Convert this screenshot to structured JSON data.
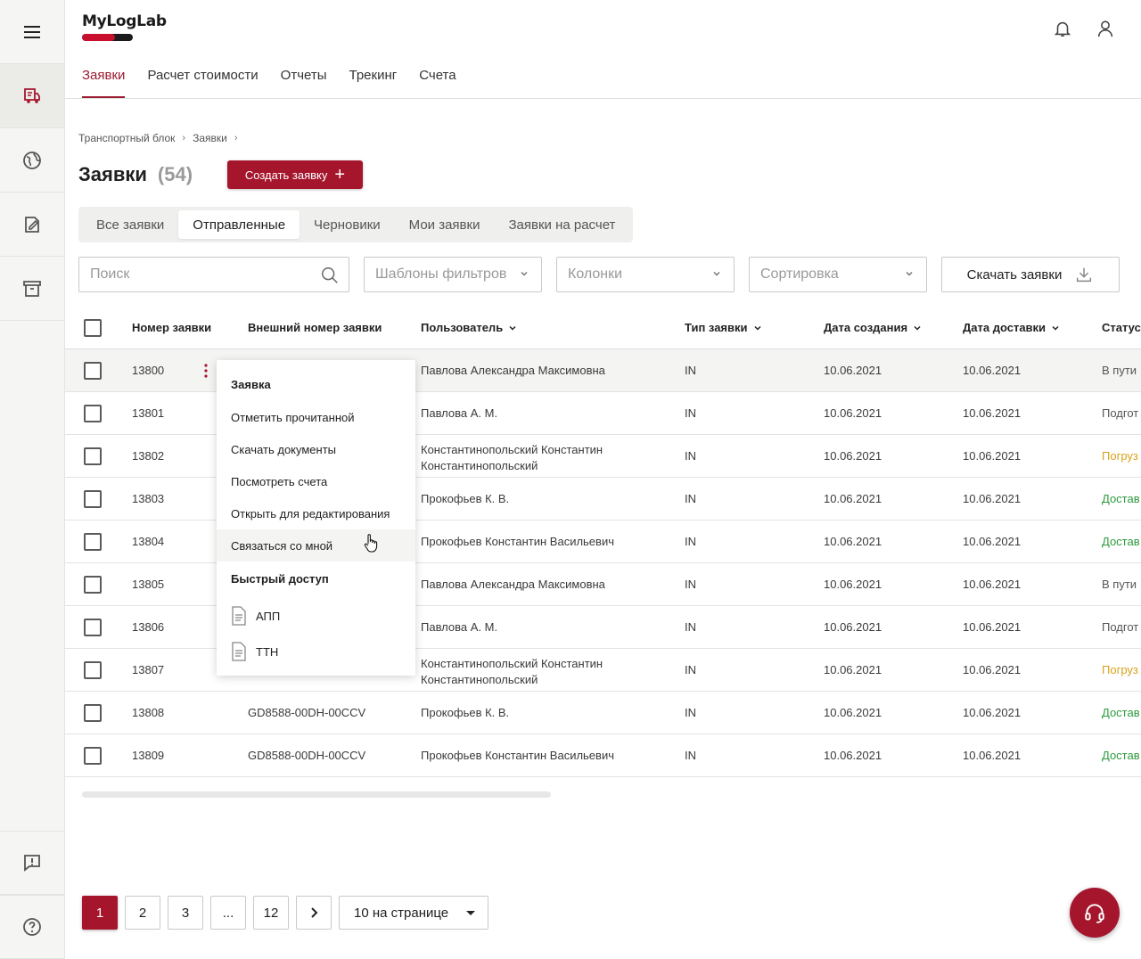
{
  "app": {
    "logo": "MyLogLab"
  },
  "topnav": [
    "Заявки",
    "Расчет стоимости",
    "Отчеты",
    "Трекинг",
    "Счета"
  ],
  "breadcrumb": [
    "Транспортный блок",
    "Заявки"
  ],
  "page": {
    "title": "Заявки",
    "count": "(54)",
    "create_label": "Создать заявку"
  },
  "segments": [
    "Все заявки",
    "Отправленные",
    "Черновики",
    "Мои заявки",
    "Заявки на расчет"
  ],
  "filters": {
    "search_placeholder": "Поиск",
    "templates": "Шаблоны фильтров",
    "columns": "Колонки",
    "sort": "Сортировка",
    "download_label": "Скачать заявки"
  },
  "table": {
    "headers": [
      "Номер заявки",
      "Внешний номер заявки",
      "Пользователь",
      "Тип заявки",
      "Дата создания",
      "Дата доставки",
      "Статус"
    ],
    "rows": [
      {
        "num": "13800",
        "ext": "",
        "user": "Павлова Александра Максимовна",
        "type": "IN",
        "created": "10.06.2021",
        "delivery": "10.06.2021",
        "status": "В пути"
      },
      {
        "num": "13801",
        "ext": "",
        "user": "Павлова А. М.",
        "type": "IN",
        "created": "10.06.2021",
        "delivery": "10.06.2021",
        "status": "Подгот"
      },
      {
        "num": "13802",
        "ext": "",
        "user": "Константинопольский Константин Константинопольский",
        "type": "IN",
        "created": "10.06.2021",
        "delivery": "10.06.2021",
        "status": "Погруз"
      },
      {
        "num": "13803",
        "ext": "",
        "user": "Прокофьев К. В.",
        "type": "IN",
        "created": "10.06.2021",
        "delivery": "10.06.2021",
        "status": "Достав"
      },
      {
        "num": "13804",
        "ext": "",
        "user": "Прокофьев Константин Васильевич",
        "type": "IN",
        "created": "10.06.2021",
        "delivery": "10.06.2021",
        "status": "Достав"
      },
      {
        "num": "13805",
        "ext": "",
        "user": "Павлова Александра Максимовна",
        "type": "IN",
        "created": "10.06.2021",
        "delivery": "10.06.2021",
        "status": "В пути"
      },
      {
        "num": "13806",
        "ext": "",
        "user": "Павлова А. М.",
        "type": "IN",
        "created": "10.06.2021",
        "delivery": "10.06.2021",
        "status": "Подгот"
      },
      {
        "num": "13807",
        "ext": "",
        "user": "Константинопольский Константин Константинопольский",
        "type": "IN",
        "created": "10.06.2021",
        "delivery": "10.06.2021",
        "status": "Погруз"
      },
      {
        "num": "13808",
        "ext": "GD8588-00DH-00CCV",
        "user": "Прокофьев К. В.",
        "type": "IN",
        "created": "10.06.2021",
        "delivery": "10.06.2021",
        "status": "Достав"
      },
      {
        "num": "13809",
        "ext": "GD8588-00DH-00CCV",
        "user": "Прокофьев Константин Васильевич",
        "type": "IN",
        "created": "10.06.2021",
        "delivery": "10.06.2021",
        "status": "Достав"
      }
    ]
  },
  "context_menu": {
    "header": "Заявка",
    "items": [
      "Отметить прочитанной",
      "Скачать документы",
      "Посмотреть счета",
      "Открыть для редактирования",
      "Связаться со мной"
    ],
    "quick_header": "Быстрый доступ",
    "docs": [
      "АПП",
      "ТТН"
    ]
  },
  "pagination": {
    "pages": [
      "1",
      "2",
      "3",
      "...",
      "12"
    ],
    "per_page": "10 на странице"
  },
  "colors": {
    "accent": "#a5162d",
    "status_yellow": "#d8a11a",
    "status_green": "#2d9b3e"
  }
}
